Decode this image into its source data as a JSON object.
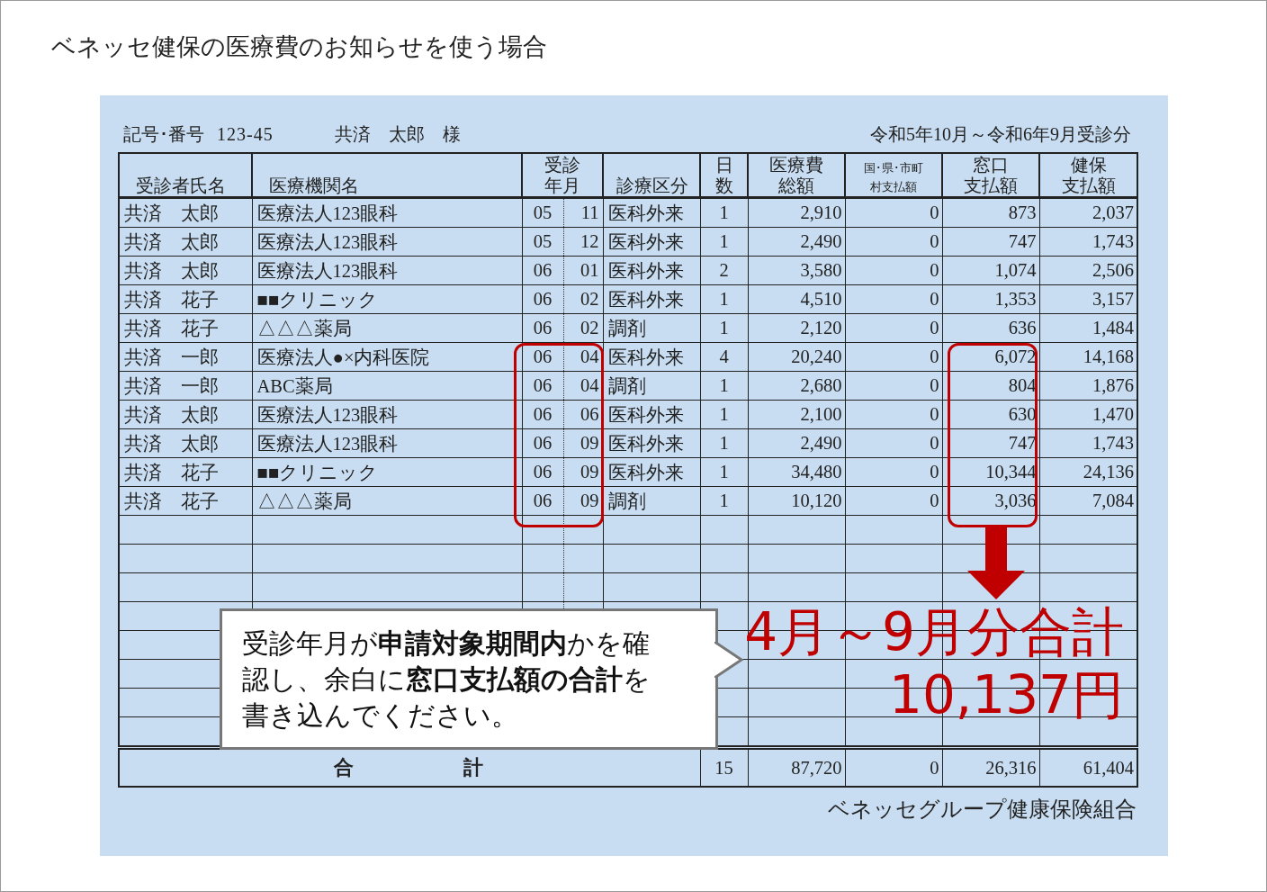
{
  "title": "ベネッセ健保の医療費のお知らせを使う場合",
  "document": {
    "id_label": "記号･番号",
    "id_number": "123-45",
    "recipient": "共済　太郎　様",
    "period": "令和5年10月～令和6年9月受診分",
    "columns": [
      {
        "lines": [
          "受診者氏名"
        ]
      },
      {
        "lines": [
          "医療機関名"
        ]
      },
      {
        "lines": [
          "受診",
          "年月"
        ]
      },
      {
        "lines": [
          "診療区分"
        ]
      },
      {
        "lines": [
          "日",
          "数"
        ]
      },
      {
        "lines": [
          "医療費",
          "総額"
        ]
      },
      {
        "lines": [
          "国･県･市町",
          "村支払額"
        ]
      },
      {
        "lines": [
          "窓口",
          "支払額"
        ]
      },
      {
        "lines": [
          "健保",
          "支払額"
        ]
      }
    ],
    "rows": [
      {
        "patient": "共済　太郎",
        "institution": "医療法人123眼科",
        "year": "05",
        "month": "11",
        "category": "医科外来",
        "days": "1",
        "total": "2,910",
        "public": "0",
        "copay": "873",
        "insurer": "2,037"
      },
      {
        "patient": "共済　太郎",
        "institution": "医療法人123眼科",
        "year": "05",
        "month": "12",
        "category": "医科外来",
        "days": "1",
        "total": "2,490",
        "public": "0",
        "copay": "747",
        "insurer": "1,743"
      },
      {
        "patient": "共済　太郎",
        "institution": "医療法人123眼科",
        "year": "06",
        "month": "01",
        "category": "医科外来",
        "days": "2",
        "total": "3,580",
        "public": "0",
        "copay": "1,074",
        "insurer": "2,506"
      },
      {
        "patient": "共済　花子",
        "institution": "■■クリニック",
        "year": "06",
        "month": "02",
        "category": "医科外来",
        "days": "1",
        "total": "4,510",
        "public": "0",
        "copay": "1,353",
        "insurer": "3,157"
      },
      {
        "patient": "共済　花子",
        "institution": "△△△薬局",
        "year": "06",
        "month": "02",
        "category": "調剤",
        "days": "1",
        "total": "2,120",
        "public": "0",
        "copay": "636",
        "insurer": "1,484"
      },
      {
        "patient": "共済　一郎",
        "institution": "医療法人●×内科医院",
        "year": "06",
        "month": "04",
        "category": "医科外来",
        "days": "4",
        "total": "20,240",
        "public": "0",
        "copay": "6,072",
        "insurer": "14,168"
      },
      {
        "patient": "共済　一郎",
        "institution": "ABC薬局",
        "year": "06",
        "month": "04",
        "category": "調剤",
        "days": "1",
        "total": "2,680",
        "public": "0",
        "copay": "804",
        "insurer": "1,876"
      },
      {
        "patient": "共済　太郎",
        "institution": "医療法人123眼科",
        "year": "06",
        "month": "06",
        "category": "医科外来",
        "days": "1",
        "total": "2,100",
        "public": "0",
        "copay": "630",
        "insurer": "1,470"
      },
      {
        "patient": "共済　太郎",
        "institution": "医療法人123眼科",
        "year": "06",
        "month": "09",
        "category": "医科外来",
        "days": "1",
        "total": "2,490",
        "public": "0",
        "copay": "747",
        "insurer": "1,743"
      },
      {
        "patient": "共済　花子",
        "institution": "■■クリニック",
        "year": "06",
        "month": "09",
        "category": "医科外来",
        "days": "1",
        "total": "34,480",
        "public": "0",
        "copay": "10,344",
        "insurer": "24,136"
      },
      {
        "patient": "共済　花子",
        "institution": "△△△薬局",
        "year": "06",
        "month": "09",
        "category": "調剤",
        "days": "1",
        "total": "10,120",
        "public": "0",
        "copay": "3,036",
        "insurer": "7,084"
      }
    ],
    "totals": {
      "label": "合　　　　　計",
      "days": "15",
      "total": "87,720",
      "public": "0",
      "copay": "26,316",
      "insurer": "61,404"
    },
    "footer": "ベネッセグループ健康保険組合"
  },
  "callout": {
    "text": "受診年月が**申請対象期間内**かを確認し、余白に**窓口支払額の合計**を書き込んでください。"
  },
  "annotation": {
    "line1": "4月～9月分合計",
    "line2": "10,137円"
  }
}
